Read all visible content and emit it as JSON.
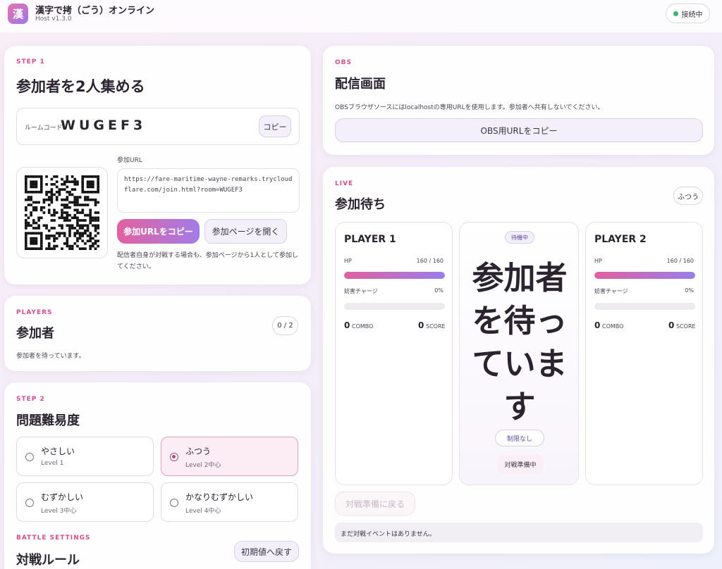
{
  "header": {
    "logo_char": "漢",
    "title": "漢字で拷（ごう）オンライン",
    "version": "Host v1.3.0",
    "connection": "接続中",
    "connection_color": "#3cb371"
  },
  "step1": {
    "eyebrow": "STEP 1",
    "title": "参加者を2人集める",
    "room_label": "ルームコード",
    "room_code": "WUGEF3",
    "copy_label": "コピー",
    "url_label": "参加URL",
    "url": "https://fare-maritime-wayne-remarks.trycloudflare.com/join.html?room=WUGEF3",
    "copy_url_button": "参加URLをコピー",
    "open_page_button": "参加ページを開く",
    "note": "配信者自身が対戦する場合も、参加ページから1人として参加してください。"
  },
  "players": {
    "eyebrow": "PLAYERS",
    "title": "参加者",
    "count": "0 / 2",
    "status": "参加者を待っています。"
  },
  "step2": {
    "eyebrow": "STEP 2",
    "title": "問題難易度",
    "options": [
      {
        "name": "やさしい",
        "level": "Level 1",
        "selected": false
      },
      {
        "name": "ふつう",
        "level": "Level 2中心",
        "selected": true
      },
      {
        "name": "むずかしい",
        "level": "Level 3中心",
        "selected": false
      },
      {
        "name": "かなりむずかしい",
        "level": "Level 4中心",
        "selected": false
      }
    ]
  },
  "battle": {
    "eyebrow": "BATTLE SETTINGS",
    "title": "対戦ルール",
    "reset_button": "初期値へ戻す"
  },
  "obs": {
    "eyebrow": "OBS",
    "title": "配信画面",
    "description": "OBSブラウザソースにはlocalhostの専用URLを使用します。参加者へ共有しないでください。",
    "copy_button": "OBS用URLをコピー"
  },
  "live": {
    "eyebrow": "LIVE",
    "title": "参加待ち",
    "difficulty_badge": "ふつう",
    "player1": {
      "name": "PLAYER 1",
      "hp_label": "HP",
      "hp_value": "160 / 160",
      "hp_fraction": 1.0,
      "charge_label": "妨害チャージ",
      "charge_value": "0%",
      "charge_fraction": 0,
      "combo": "0",
      "combo_label": "COMBO",
      "score": "0",
      "score_label": "SCORE"
    },
    "player2": {
      "name": "PLAYER 2",
      "hp_label": "HP",
      "hp_value": "160 / 160",
      "hp_fraction": 1.0,
      "charge_label": "妨害チャージ",
      "charge_value": "0%",
      "charge_fraction": 0,
      "combo": "0",
      "combo_label": "COMBO",
      "score": "0",
      "score_label": "SCORE"
    },
    "center": {
      "badge": "待機中",
      "message": "参加者を待っています",
      "limit": "制限なし",
      "status": "対戦準備中"
    },
    "back_button": "対戦準備に戻る",
    "event_log": "まだ対戦イベントはありません。"
  }
}
